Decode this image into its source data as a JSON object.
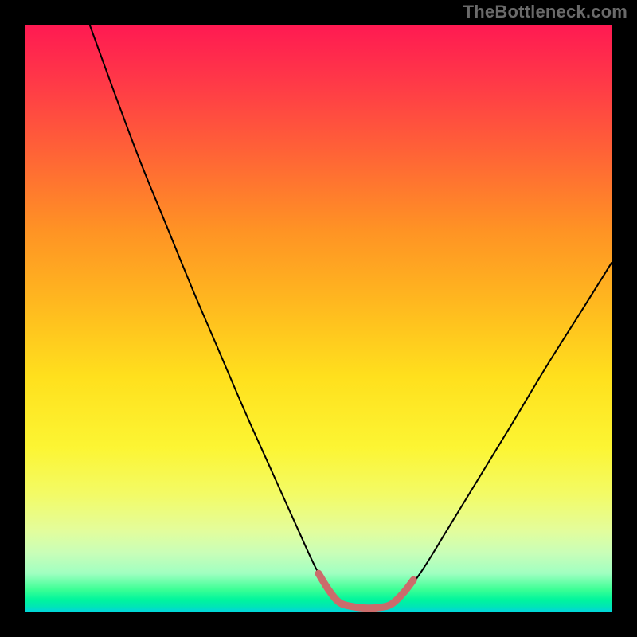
{
  "watermark": "TheBottleneck.com",
  "chart_data": {
    "type": "line",
    "title": "",
    "xlabel": "",
    "ylabel": "",
    "xlim": [
      0,
      100
    ],
    "ylim": [
      0,
      100
    ],
    "grid": false,
    "legend": false,
    "series": [
      {
        "name": "black-curve",
        "color": "#000000",
        "width": 2.0,
        "points": [
          {
            "x": 11.0,
            "y": 100.0
          },
          {
            "x": 15.0,
            "y": 89.0
          },
          {
            "x": 19.5,
            "y": 77.0
          },
          {
            "x": 24.0,
            "y": 66.0
          },
          {
            "x": 28.5,
            "y": 55.0
          },
          {
            "x": 33.0,
            "y": 44.5
          },
          {
            "x": 37.5,
            "y": 34.0
          },
          {
            "x": 42.0,
            "y": 24.0
          },
          {
            "x": 46.5,
            "y": 14.0
          },
          {
            "x": 49.5,
            "y": 7.5
          },
          {
            "x": 52.0,
            "y": 3.2
          },
          {
            "x": 54.0,
            "y": 1.2
          },
          {
            "x": 57.0,
            "y": 0.6
          },
          {
            "x": 60.0,
            "y": 0.6
          },
          {
            "x": 62.5,
            "y": 1.2
          },
          {
            "x": 65.0,
            "y": 3.4
          },
          {
            "x": 68.0,
            "y": 7.5
          },
          {
            "x": 72.0,
            "y": 14.0
          },
          {
            "x": 77.5,
            "y": 23.0
          },
          {
            "x": 83.0,
            "y": 32.0
          },
          {
            "x": 89.0,
            "y": 42.0
          },
          {
            "x": 95.0,
            "y": 51.5
          },
          {
            "x": 100.0,
            "y": 59.5
          }
        ]
      },
      {
        "name": "accent-segment",
        "color": "#cb6c6b",
        "width": 9.0,
        "cap": "round",
        "points": [
          {
            "x": 50.0,
            "y": 6.5
          },
          {
            "x": 51.8,
            "y": 3.6
          },
          {
            "x": 53.5,
            "y": 1.6
          },
          {
            "x": 55.5,
            "y": 0.9
          },
          {
            "x": 58.0,
            "y": 0.6
          },
          {
            "x": 60.5,
            "y": 0.7
          },
          {
            "x": 62.5,
            "y": 1.3
          },
          {
            "x": 64.5,
            "y": 3.2
          },
          {
            "x": 66.2,
            "y": 5.4
          }
        ]
      }
    ],
    "background_gradient": {
      "direction": "top-to-bottom",
      "stops": [
        {
          "pos": 0.0,
          "color": "#ff1a52"
        },
        {
          "pos": 0.1,
          "color": "#ff3a47"
        },
        {
          "pos": 0.22,
          "color": "#ff6436"
        },
        {
          "pos": 0.35,
          "color": "#ff9324"
        },
        {
          "pos": 0.47,
          "color": "#ffb71f"
        },
        {
          "pos": 0.6,
          "color": "#ffe01d"
        },
        {
          "pos": 0.72,
          "color": "#fcf533"
        },
        {
          "pos": 0.8,
          "color": "#f3fb66"
        },
        {
          "pos": 0.86,
          "color": "#e4fd9a"
        },
        {
          "pos": 0.9,
          "color": "#c9feb8"
        },
        {
          "pos": 0.935,
          "color": "#a0ffc1"
        },
        {
          "pos": 0.963,
          "color": "#3bff95"
        },
        {
          "pos": 0.98,
          "color": "#00f59d"
        },
        {
          "pos": 0.991,
          "color": "#00e6b4"
        },
        {
          "pos": 1.0,
          "color": "#00d6da"
        }
      ]
    }
  }
}
